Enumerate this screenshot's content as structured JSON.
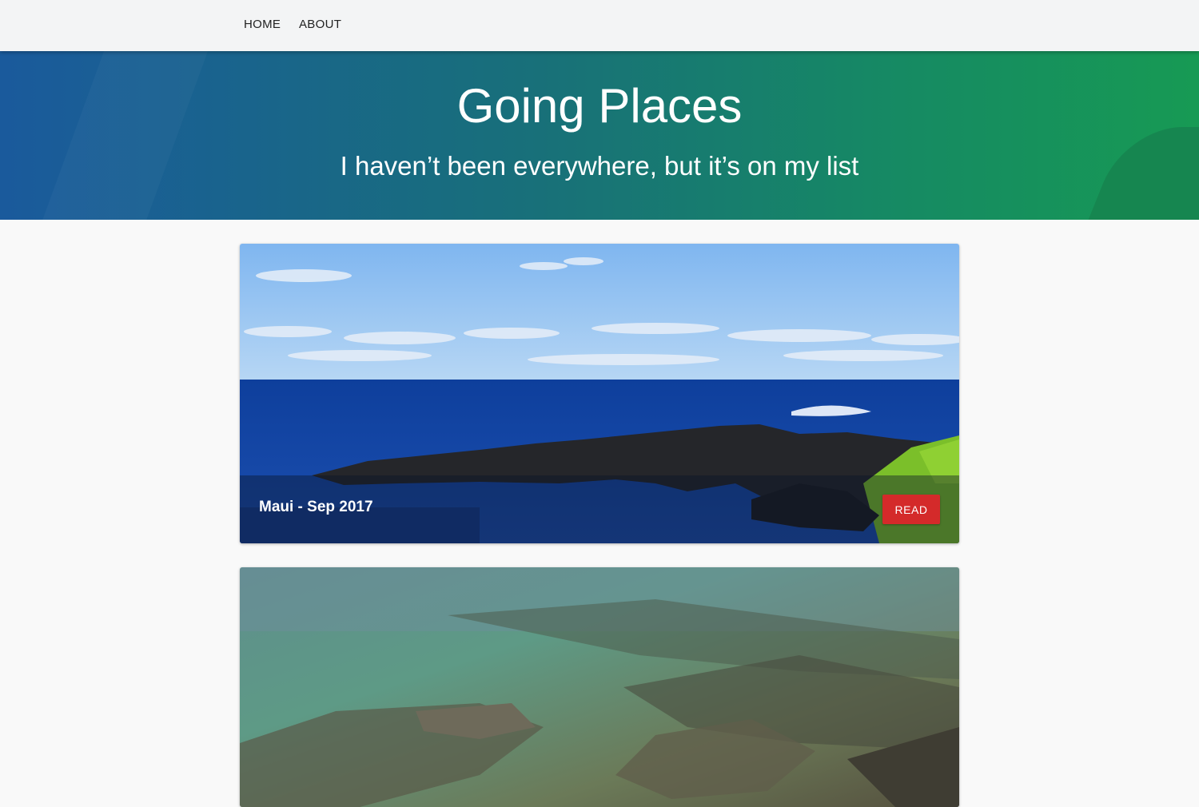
{
  "nav": {
    "items": [
      {
        "label": "HOME"
      },
      {
        "label": "ABOUT"
      }
    ]
  },
  "hero": {
    "title": "Going Places",
    "subtitle": "I haven’t been everywhere, but it’s on my list"
  },
  "posts": [
    {
      "title": "Maui - Sep 2017",
      "button_label": "READ"
    },
    {
      "title": "",
      "button_label": ""
    }
  ],
  "colors": {
    "accent": "#d42a2a",
    "hero_start": "#1a5a9c",
    "hero_end": "#179a54",
    "navbar": "#f3f4f5"
  }
}
